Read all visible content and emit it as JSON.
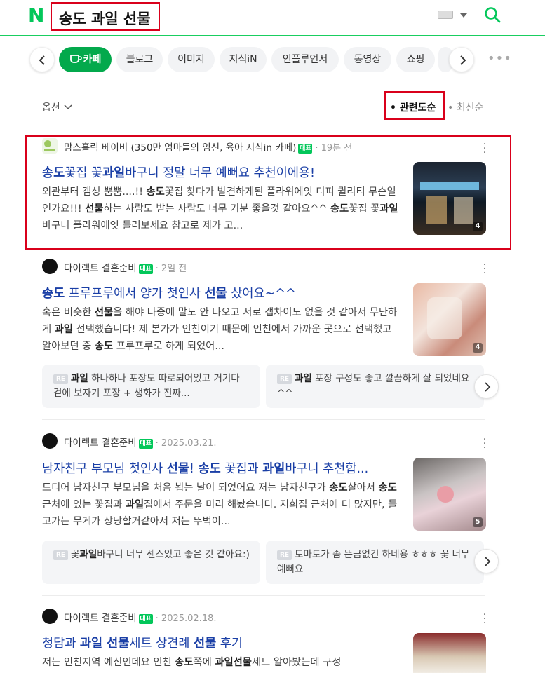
{
  "header": {
    "logo": "N",
    "query": "송도 과일 선물"
  },
  "tabs": [
    {
      "label": "카페",
      "active": true
    },
    {
      "label": "블로그"
    },
    {
      "label": "이미지"
    },
    {
      "label": "지식iN"
    },
    {
      "label": "인플루언서"
    },
    {
      "label": "동영상"
    },
    {
      "label": "쇼핑"
    }
  ],
  "toolbar": {
    "options_label": "옵션",
    "sort_relevance": "관련도순",
    "sort_newest": "최신순"
  },
  "posts": [
    {
      "source": "맘스홀릭 베이비 (350만 엄마들의 임신, 육아 지식in 카페)",
      "badge": "대표",
      "time": "19분 전",
      "title_parts": [
        "송도",
        "꽃집 꽃",
        "과일",
        "바구니 정말 너무 예뻐요 추천이에용!"
      ],
      "desc_parts": [
        "외관부터 갬성 뿜뿜....!! ",
        "송도",
        "꽃집 찾다가 발견하게된 플라워에잇 디피 퀄리티 무슨일인가요!!! ",
        "선물",
        "하는 사람도 받는 사람도 너무 기분 좋을것 같아요^^ ",
        "송도",
        "꽃집 꽃",
        "과일",
        "바구니 플라워에잇 들러보세요 참고로 제가 고..."
      ],
      "thumb_count": "4"
    },
    {
      "source": "다이렉트 결혼준비",
      "badge": "대표",
      "time": "2일 전",
      "title_parts": [
        "송도",
        " 프루프루에서 양가 첫인사 ",
        "선물",
        " 샀어요~^^"
      ],
      "desc_parts": [
        "혹은 비슷한 ",
        "선물",
        "을 해야 나중에 말도 안 나오고 서로 갭차이도 없을 것 같아서 무난하게 ",
        "과일",
        " 선택했습니다! 제 본가가 인천이기 때문에 인천에서 가까운 곳으로 선택했고 알아보던 중 ",
        "송도",
        " 프루프루로 하게 되었어..."
      ],
      "thumb_count": "4",
      "replies": [
        {
          "tag": "RE",
          "parts": [
            "과일",
            " 하나하나 포장도 따로되어있고 거기다 겉에 보자기 포장 + 생화가 진짜..."
          ]
        },
        {
          "tag": "RE",
          "parts": [
            "과일",
            " 포장 구성도 좋고 깔끔하게 잘 되었네요^^"
          ]
        }
      ]
    },
    {
      "source": "다이렉트 결혼준비",
      "badge": "대표",
      "time": "2025.03.21.",
      "title_parts": [
        "남자친구 부모님 첫인사 ",
        "선물",
        "! ",
        "송도",
        " 꽃집과 ",
        "과일",
        "바구니 추천합..."
      ],
      "desc_parts": [
        "드디어 남자친구 부모님을 처음 뵙는 날이 되었어요 저는 남자친구가 ",
        "송도",
        "살아서 ",
        "송도",
        " 근처에 있는 꽃집과 ",
        "과일",
        "집에서 주문을 미리 해놨습니다. 저희집 근처에 더 많지만, 들고가는 무게가 상당할거같아서 저는 뚜벅이..."
      ],
      "thumb_count": "5",
      "replies": [
        {
          "tag": "RE",
          "parts": [
            "꽃",
            "과일",
            "바구니 너무 센스있고 좋은 것 같아요:)"
          ]
        },
        {
          "tag": "RE",
          "parts": [
            "토마토가 좀 뜬금없긴 하네용 ㅎㅎㅎ 꽃 너무 예뻐요",
            "",
            ""
          ]
        }
      ]
    },
    {
      "source": "다이렉트 결혼준비",
      "badge": "대표",
      "time": "2025.02.18.",
      "title_parts": [
        "청담과 ",
        "과일 선물",
        "세트 상견례 ",
        "선물",
        " 후기"
      ],
      "desc_parts": [
        "저는 인천지역 예신인데요 인천 ",
        "송도",
        "쪽에 ",
        "과일선물",
        "세트 알아봤는데 구성"
      ]
    }
  ],
  "colors": {
    "accent": "#03c75a",
    "title_blue": "#1a3fa6",
    "highlight_red": "#d9001b"
  },
  "icons": [
    "naver-logo",
    "keyboard-icon",
    "search-icon",
    "chevron-left-icon",
    "coffee-cup-icon",
    "chevron-right-icon",
    "more-icon",
    "kebab-icon"
  ]
}
